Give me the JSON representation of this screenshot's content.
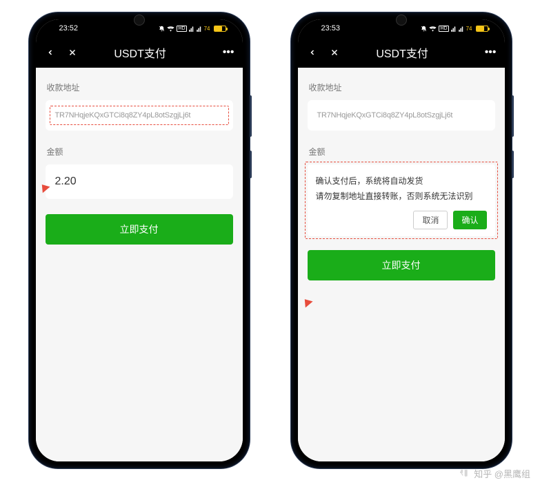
{
  "watermark": "知乎 @黑鹰组",
  "phone_left": {
    "time": "23:52",
    "battery": "74",
    "title": "USDT支付",
    "section_address_label": "收款地址",
    "address": "TR7NHqjeKQxGTCi8q8ZY4pL8otSzgjLj6t",
    "section_amount_label": "金额",
    "amount": "2.20",
    "pay_button": "立即支付"
  },
  "phone_right": {
    "time": "23:53",
    "battery": "74",
    "title": "USDT支付",
    "section_address_label": "收款地址",
    "address": "TR7NHqjeKQxGTCi8q8ZY4pL8otSzgjLj6t",
    "section_amount_label": "金额",
    "dialog_line1": "确认支付后，系统将自动发货",
    "dialog_line2": "请勿复制地址直接转账，否则系统无法识别",
    "cancel": "取消",
    "confirm": "确认",
    "pay_button": "立即支付"
  }
}
